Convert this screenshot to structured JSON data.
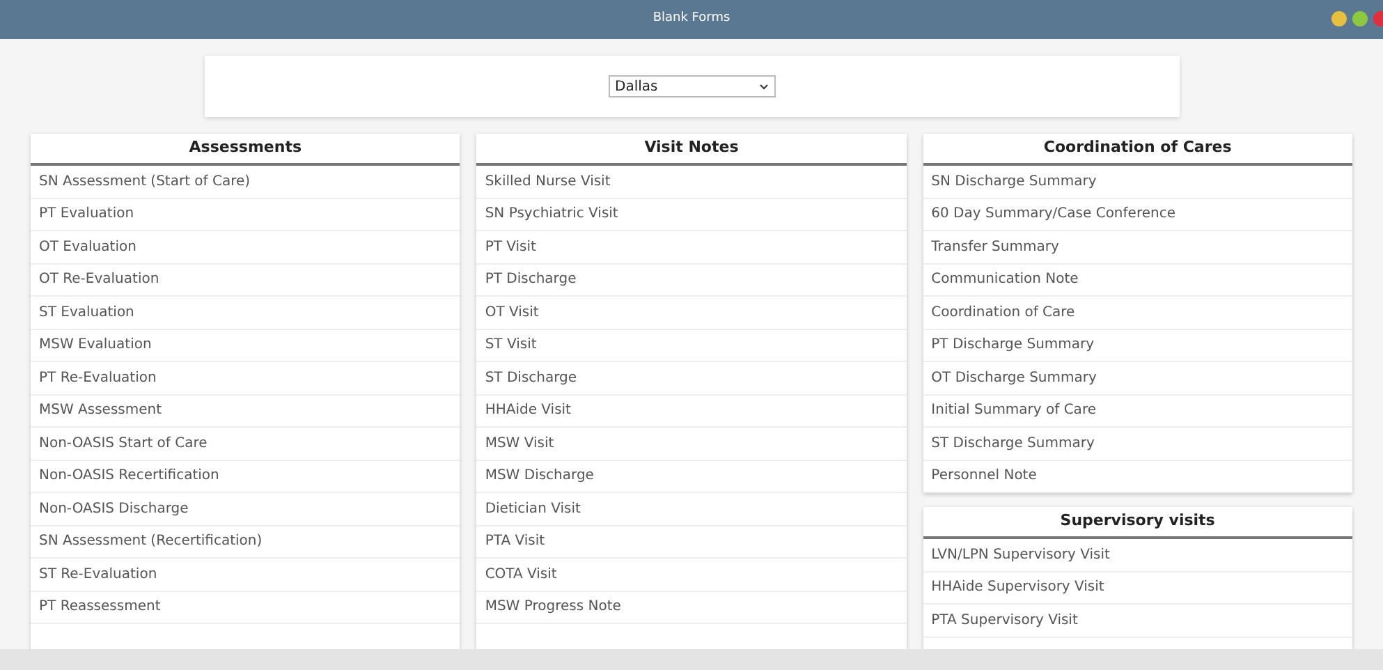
{
  "window": {
    "title": "Blank Forms"
  },
  "location_select": {
    "value": "Dallas"
  },
  "columns": [
    {
      "sections": [
        {
          "title": "Assessments",
          "items": [
            "SN Assessment (Start of Care)",
            "PT Evaluation",
            "OT Evaluation",
            "OT Re-Evaluation",
            "ST Evaluation",
            "MSW Evaluation",
            "PT Re-Evaluation",
            "MSW Assessment",
            "Non-OASIS Start of Care",
            "Non-OASIS Recertification",
            "Non-OASIS Discharge",
            "SN Assessment (Recertification)",
            "ST Re-Evaluation",
            "PT Reassessment"
          ]
        }
      ]
    },
    {
      "sections": [
        {
          "title": "Visit Notes",
          "items": [
            "Skilled Nurse Visit",
            "SN Psychiatric Visit",
            "PT Visit",
            "PT Discharge",
            "OT Visit",
            "ST Visit",
            "ST Discharge",
            "HHAide Visit",
            "MSW Visit",
            "MSW Discharge",
            "Dietician Visit",
            "PTA Visit",
            "COTA Visit",
            "MSW Progress Note"
          ]
        }
      ]
    },
    {
      "sections": [
        {
          "title": "Coordination of Cares",
          "items": [
            "SN Discharge Summary",
            "60 Day Summary/Case Conference",
            "Transfer Summary",
            "Communication Note",
            "Coordination of Care",
            "PT Discharge Summary",
            "OT Discharge Summary",
            "Initial Summary of Care",
            "ST Discharge Summary",
            "Personnel Note"
          ]
        },
        {
          "title": "Supervisory visits",
          "items": [
            "LVN/LPN Supervisory Visit",
            "HHAide Supervisory Visit",
            "PTA Supervisory Visit"
          ]
        }
      ]
    }
  ]
}
